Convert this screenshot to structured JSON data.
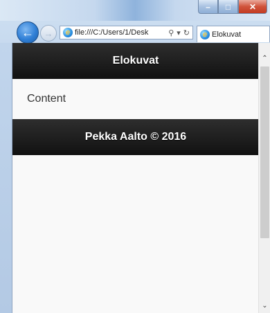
{
  "browser": {
    "address_url": "file:///C:/Users/1/Desk",
    "search_symbol": "⚲",
    "dropdown_symbol": "▾",
    "refresh_symbol": "↻",
    "tab_title": "Elokuvat",
    "window_buttons": {
      "minimize": "–",
      "maximize": "□",
      "close": "✕"
    }
  },
  "page": {
    "header_title": "Elokuvat",
    "content_text": "Content",
    "footer_text": "Pekka Aalto © 2016"
  }
}
